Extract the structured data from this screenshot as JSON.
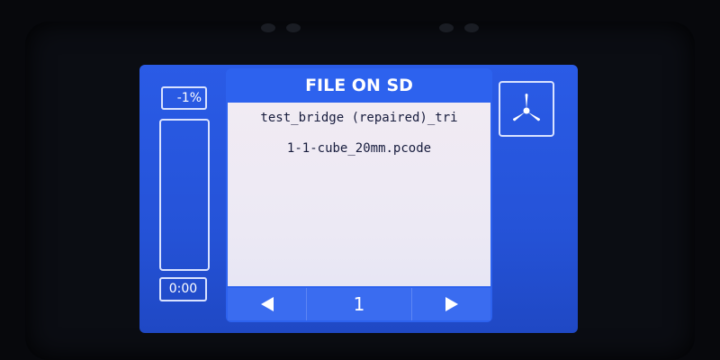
{
  "status": {
    "progress_label": "-1%",
    "progress_value": 0,
    "elapsed_time": "0:00"
  },
  "dialog": {
    "title": "FILE ON SD",
    "files": [
      "test_bridge (repaired)_tri",
      "1-1-cube_20mm.pcode",
      "",
      "",
      "",
      ""
    ],
    "pager": {
      "prev_icon": "left-arrow-icon",
      "page": "1",
      "next_icon": "right-arrow-icon"
    }
  },
  "side_button": {
    "icon": "fan-icon"
  },
  "colors": {
    "screen_blue": "#2553d8",
    "dialog_blue": "#2d62ee",
    "list_background": "#ece9f4",
    "border_light": "#d9e2ff",
    "text_dark": "#171c3d"
  }
}
